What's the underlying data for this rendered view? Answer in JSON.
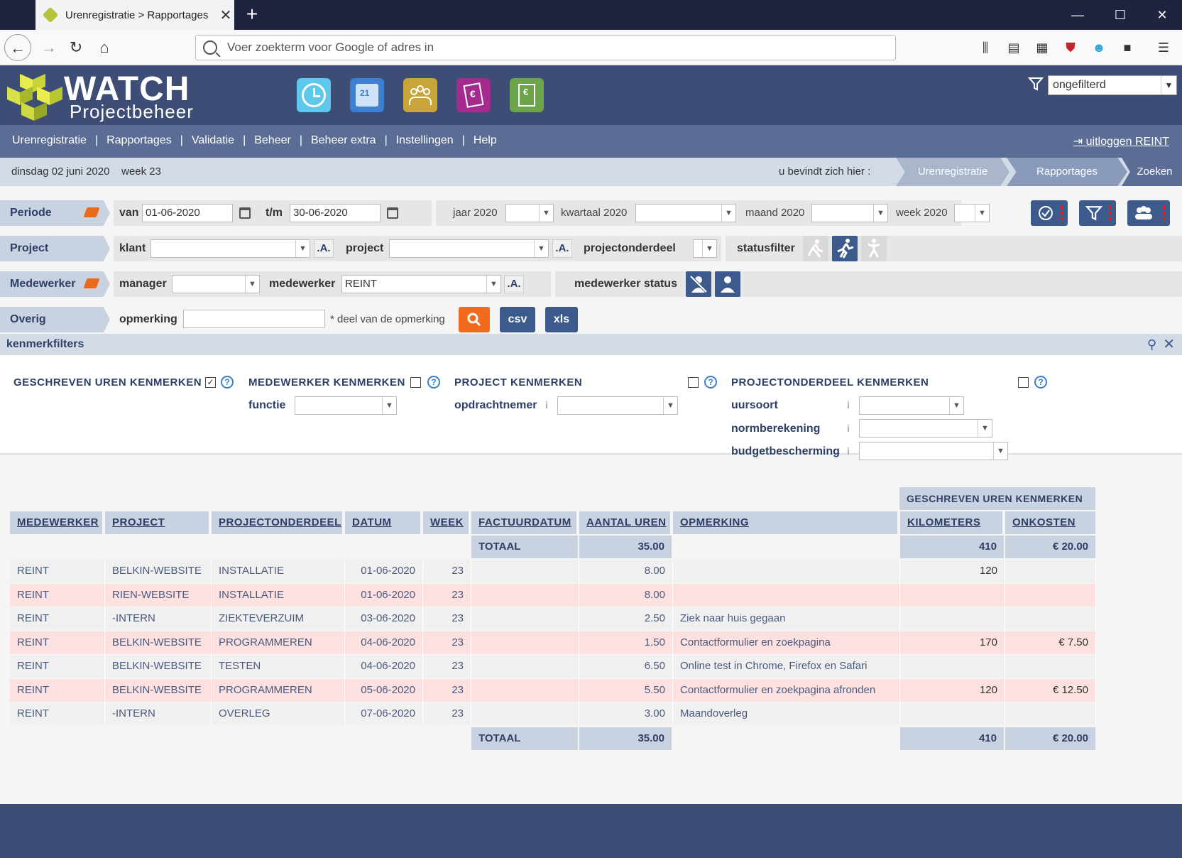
{
  "browser": {
    "tab_title": "Urenregistratie > Rapportages",
    "tab_close": "✕",
    "new_tab": "+",
    "url_placeholder": "Voer zoekterm voor Google of adres in",
    "win_min": "—",
    "win_max": "☐",
    "win_close": "✕"
  },
  "header": {
    "brand_top": "WATCH",
    "brand_bottom": "Projectbeheer",
    "filter_value": "ongefilterd"
  },
  "menu": {
    "items": [
      "Urenregistratie",
      "Rapportages",
      "Validatie",
      "Beheer",
      "Beheer extra",
      "Instellingen",
      "Help"
    ],
    "separator": "|",
    "logout": "uitloggen REINT"
  },
  "breadcrumb": {
    "date": "dinsdag 02 juni 2020",
    "week": "week 23",
    "here_label": "u bevindt zich hier :",
    "crumbs": [
      "Urenregistratie",
      "Rapportages",
      "Zoeken"
    ]
  },
  "periode": {
    "label": "Periode",
    "van_label": "van",
    "van_value": "01-06-2020",
    "tm_label": "t/m",
    "tm_value": "30-06-2020",
    "jaar_label": "jaar 2020",
    "kwartaal_label": "kwartaal 2020",
    "maand_label": "maand 2020",
    "week_label": "week 2020"
  },
  "project": {
    "label": "Project",
    "klant_label": "klant",
    "project_label": "project",
    "onderdeel_label": "projectonderdeel",
    "statusfilter_label": "statusfilter",
    "a_btn": ".A."
  },
  "medewerker": {
    "label": "Medewerker",
    "manager_label": "manager",
    "medewerker_label": "medewerker",
    "medewerker_value": "REINT",
    "status_label": "medewerker status"
  },
  "overig": {
    "label": "Overig",
    "opmerking_label": "opmerking",
    "hint": "* deel van de opmerking",
    "csv": "csv",
    "xls": "xls"
  },
  "kenmerk": {
    "title": "kenmerkfilters",
    "groups": [
      "GESCHREVEN UREN KENMERKEN",
      "MEDEWERKER KENMERKEN",
      "PROJECT KENMERKEN",
      "PROJECTONDERDEEL KENMERKEN"
    ],
    "checkmark": "✓",
    "help": "?",
    "info": "i",
    "functie": "functie",
    "opdrachtnemer": "opdrachtnemer",
    "uursoort": "uursoort",
    "normberekening": "normberekening",
    "budgetbescherming": "budgetbescherming"
  },
  "table": {
    "group_header": "GESCHREVEN UREN KENMERKEN",
    "headers": [
      "MEDEWERKER",
      "PROJECT",
      "PROJECTONDERDEEL",
      "DATUM",
      "WEEK",
      "FACTUURDATUM",
      "AANTAL UREN",
      "OPMERKING",
      "KILOMETERS",
      "ONKOSTEN"
    ],
    "total_label": "TOTAAL",
    "total_hours": "35.00",
    "total_km": "410",
    "total_costs": "€ 20.00",
    "rows": [
      {
        "medewerker": "REINT",
        "project": "BELKIN-WEBSITE",
        "onderdeel": "INSTALLATIE",
        "datum": "01-06-2020",
        "week": "23",
        "uren": "8.00",
        "opmerking": "",
        "km": "120",
        "onkosten": ""
      },
      {
        "medewerker": "REINT",
        "project": "RIEN-WEBSITE",
        "onderdeel": "INSTALLATIE",
        "datum": "01-06-2020",
        "week": "23",
        "uren": "8.00",
        "opmerking": "",
        "km": "",
        "onkosten": ""
      },
      {
        "medewerker": "REINT",
        "project": "-INTERN",
        "onderdeel": "ZIEKTEVERZUIM",
        "datum": "03-06-2020",
        "week": "23",
        "uren": "2.50",
        "opmerking": "Ziek naar huis gegaan",
        "km": "",
        "onkosten": ""
      },
      {
        "medewerker": "REINT",
        "project": "BELKIN-WEBSITE",
        "onderdeel": "PROGRAMMEREN",
        "datum": "04-06-2020",
        "week": "23",
        "uren": "1.50",
        "opmerking": "Contactformulier en zoekpagina",
        "km": "170",
        "onkosten": "€ 7.50"
      },
      {
        "medewerker": "REINT",
        "project": "BELKIN-WEBSITE",
        "onderdeel": "TESTEN",
        "datum": "04-06-2020",
        "week": "23",
        "uren": "6.50",
        "opmerking": "Online test in Chrome, Firefox en Safari",
        "km": "",
        "onkosten": ""
      },
      {
        "medewerker": "REINT",
        "project": "BELKIN-WEBSITE",
        "onderdeel": "PROGRAMMEREN",
        "datum": "05-06-2020",
        "week": "23",
        "uren": "5.50",
        "opmerking": "Contactformulier en zoekpagina afronden",
        "km": "120",
        "onkosten": "€ 12.50"
      },
      {
        "medewerker": "REINT",
        "project": "-INTERN",
        "onderdeel": "OVERLEG",
        "datum": "07-06-2020",
        "week": "23",
        "uren": "3.00",
        "opmerking": "Maandoverleg",
        "km": "",
        "onkosten": ""
      }
    ]
  },
  "colors": {
    "header_bg": "#3d4d75",
    "menu_bg": "#5b6d95",
    "accent_orange": "#f26a1b",
    "row_pink": "#fde1e1"
  }
}
